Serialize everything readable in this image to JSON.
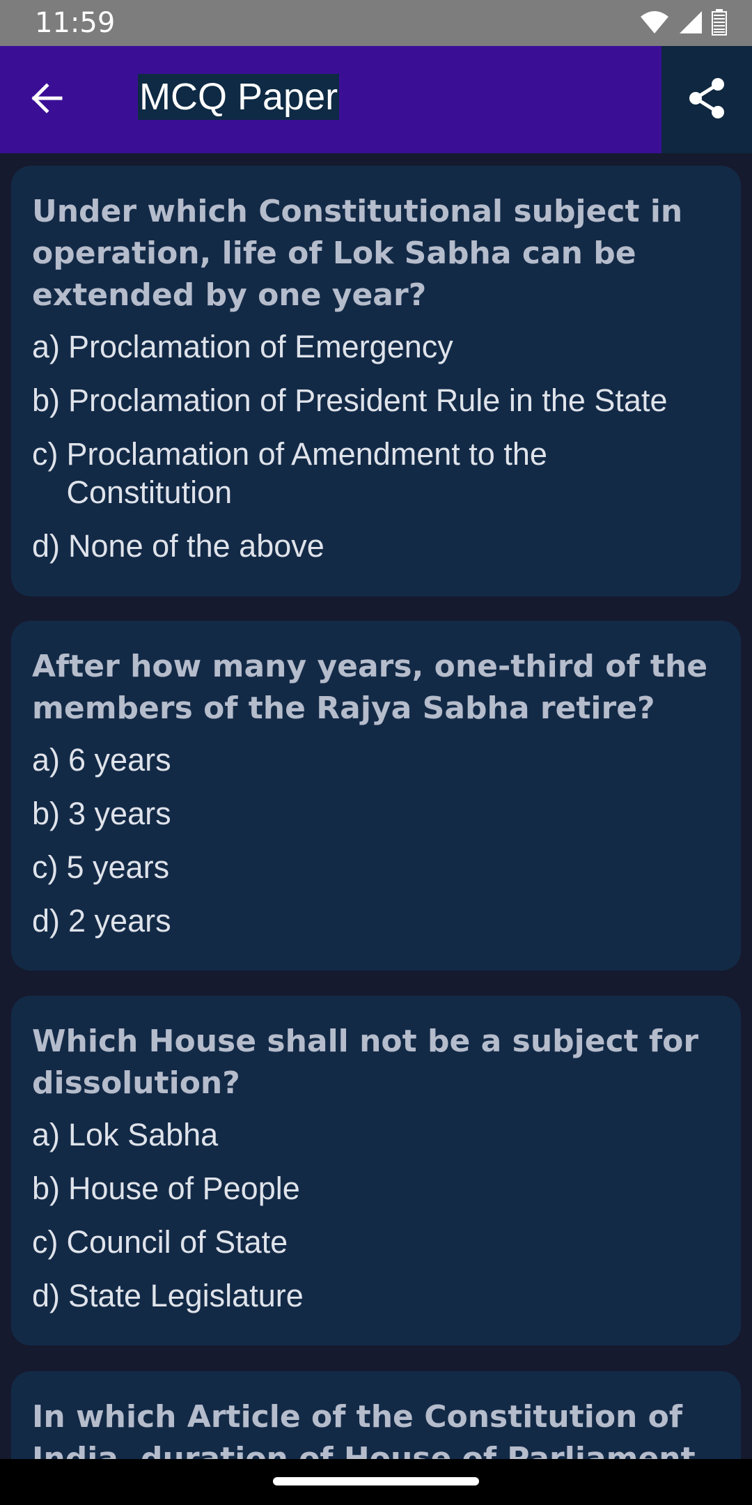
{
  "status_bar": {
    "time": "11:59",
    "icons": [
      "wifi-icon",
      "signal-icon",
      "battery-icon"
    ]
  },
  "app_bar": {
    "title": "MCQ Paper",
    "back_icon": "arrow-back-icon",
    "share_icon": "share-icon"
  },
  "questions": [
    {
      "question": "Under which Constitutional subject in operation, life of Lok Sabha can be extended by one year?",
      "options": [
        {
          "letter": "a)",
          "text": "Proclamation of Emergency"
        },
        {
          "letter": "b)",
          "text": "Proclamation of President Rule in the State"
        },
        {
          "letter": "c)",
          "text": "Proclamation of Amendment to the Constitution"
        },
        {
          "letter": "d)",
          "text": "None of the above"
        }
      ]
    },
    {
      "question": "After how many years, one-third of the members of the Rajya Sabha retire?",
      "options": [
        {
          "letter": "a)",
          "text": "6 years"
        },
        {
          "letter": "b)",
          "text": "3 years"
        },
        {
          "letter": "c)",
          "text": "5 years"
        },
        {
          "letter": "d)",
          "text": "2 years"
        }
      ]
    },
    {
      "question": "Which House shall not be a subject for dissolution?",
      "options": [
        {
          "letter": "a)",
          "text": "Lok Sabha"
        },
        {
          "letter": "b)",
          "text": "House of People"
        },
        {
          "letter": "c)",
          "text": "Council of State"
        },
        {
          "letter": "d)",
          "text": "State Legislature"
        }
      ]
    },
    {
      "question": "In which Article of the Constitution of India, duration of House of Parliament",
      "options": []
    }
  ],
  "colors": {
    "app_bar": "#3a0f96",
    "card": "#132a47",
    "background": "#151a2e",
    "question_text": "#b5bccb",
    "option_text": "#dfe3ea"
  }
}
